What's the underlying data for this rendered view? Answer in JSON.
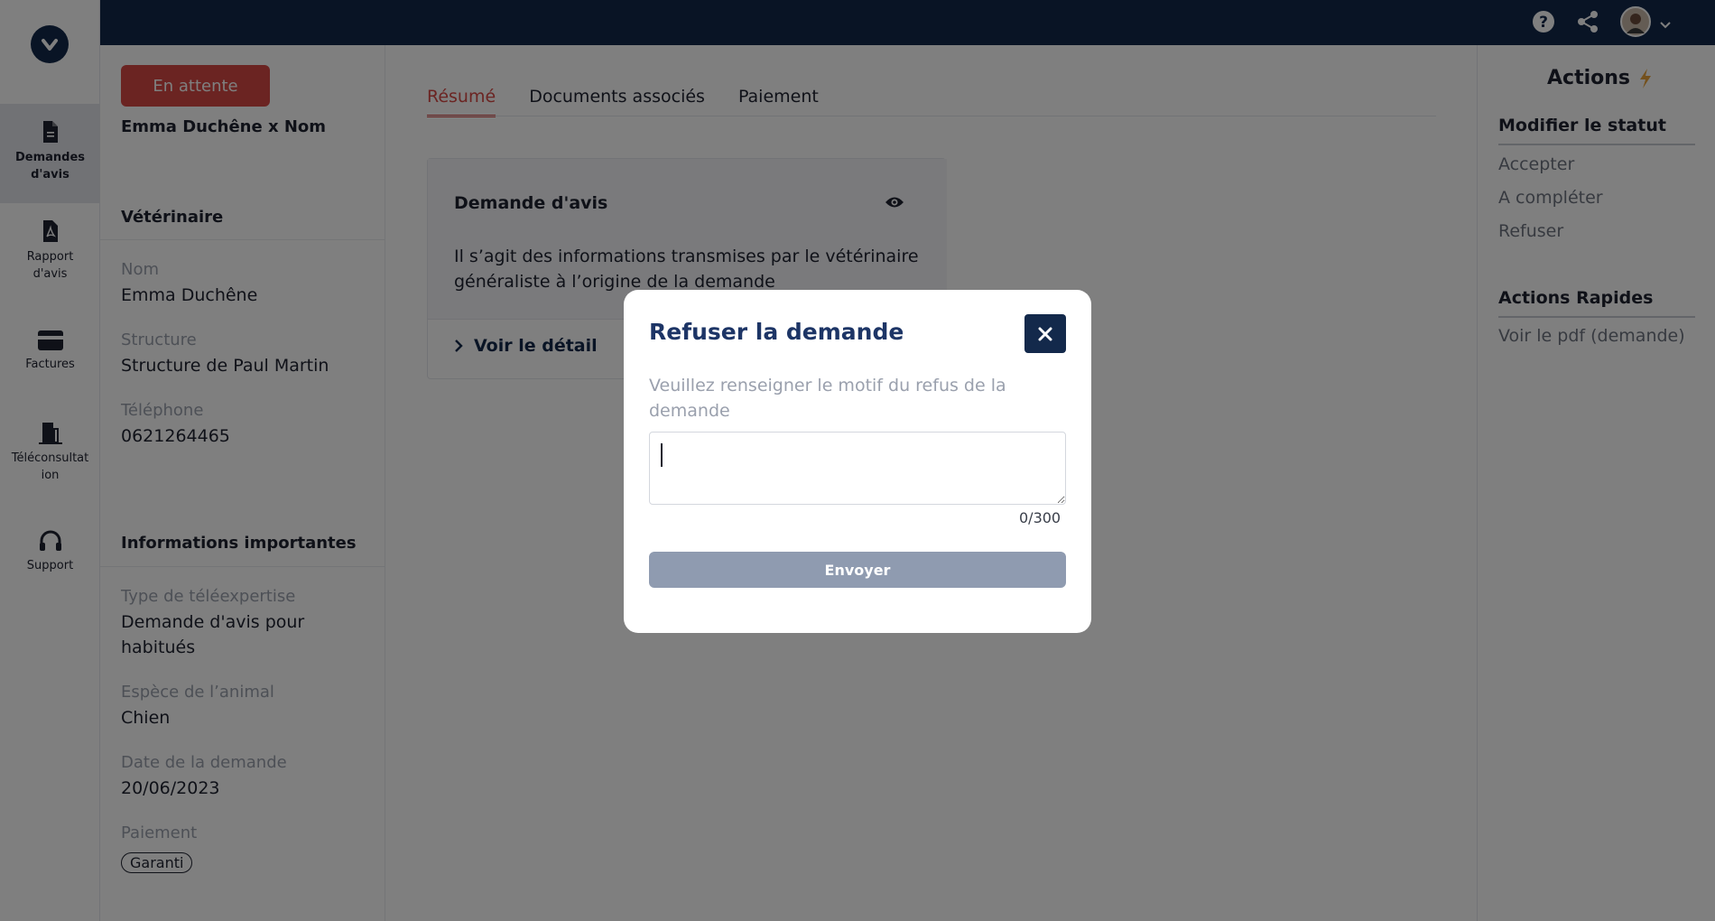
{
  "colors": {
    "brand_navy": "#13294b",
    "accent_red": "#d74945",
    "overlay": "rgba(0,0,0,0.5)"
  },
  "sidebar": {
    "items": [
      {
        "label": "Demandes d'avis",
        "icon": "document-icon",
        "active": true
      },
      {
        "label": "Rapport d'avis",
        "icon": "pdf-file-icon",
        "active": false
      },
      {
        "label": "Factures",
        "icon": "credit-card-icon",
        "active": false
      },
      {
        "label": "Téléconsultat ion",
        "icon": "door-icon",
        "active": false
      },
      {
        "label": "Support",
        "icon": "headphones-icon",
        "active": false
      }
    ]
  },
  "topbar": {
    "icons": [
      "help-icon",
      "share-icon",
      "avatar",
      "chevron-down-icon"
    ]
  },
  "info": {
    "status_button": "En attente",
    "client": "Emma Duchêne x Nom",
    "vet_section": "Vétérinaire",
    "nom_label": "Nom",
    "nom_value": "Emma Duchêne",
    "structure_label": "Structure",
    "structure_value": "Structure de Paul Martin",
    "tel_label": "Téléphone",
    "tel_value": "0621264465",
    "important_section": "Informations importantes",
    "type_label": "Type de téléexpertise",
    "type_value": "Demande d'avis pour habitués",
    "espece_label": "Espèce de l’animal",
    "espece_value": "Chien",
    "date_label": "Date de la demande",
    "date_value": "20/06/2023",
    "paiement_label": "Paiement",
    "paiement_badge": "Garanti"
  },
  "main": {
    "tabs": [
      "Résumé",
      "Documents associés",
      "Paiement"
    ],
    "active_tab": "Résumé",
    "card_title": "Demande d'avis",
    "card_text": "Il s’agit des informations transmises par le vétérinaire généraliste à l’origine de la demande",
    "card_link": "Voir le détail"
  },
  "actions": {
    "title": "Actions",
    "status_heading": "Modifier le statut",
    "status_items": [
      "Accepter",
      "A compléter",
      "Refuser"
    ],
    "quick_heading": "Actions Rapides",
    "quick_items": [
      "Voir le pdf (demande)"
    ]
  },
  "modal": {
    "title": "Refuser la demande",
    "description": "Veuillez renseigner le motif du refus de la demande",
    "textarea_value": "",
    "counter": "0/300",
    "submit_label": "Envoyer"
  }
}
